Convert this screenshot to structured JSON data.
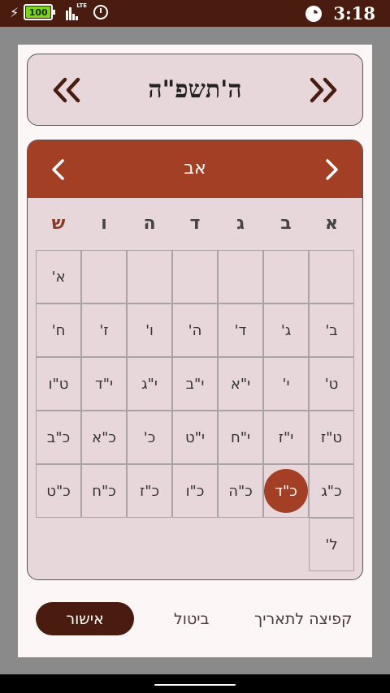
{
  "status_bar": {
    "battery_level": "100",
    "network": "LTE",
    "time": "3:18"
  },
  "year_selector": {
    "year": "ה'תשפ\"ה"
  },
  "month_selector": {
    "month": "אב"
  },
  "weekdays": [
    "א",
    "ב",
    "ג",
    "ד",
    "ה",
    "ו",
    "ש"
  ],
  "days": [
    "א'",
    "ב'",
    "ג'",
    "ד'",
    "ה'",
    "ו'",
    "ז'",
    "ח'",
    "ט'",
    "י'",
    "י\"א",
    "י\"ב",
    "י\"ג",
    "י\"ד",
    "ט\"ו",
    "ט\"ז",
    "י\"ז",
    "י\"ח",
    "י\"ט",
    "כ'",
    "כ\"א",
    "כ\"ב",
    "כ\"ג",
    "כ\"ד",
    "כ\"ה",
    "כ\"ו",
    "כ\"ז",
    "כ\"ח",
    "כ\"ט",
    "ל'"
  ],
  "first_day_column": 6,
  "selected_day": "כ\"ד",
  "actions": {
    "confirm": "אישור",
    "cancel": "ביטול",
    "jump_to_date": "קפיצה לתאריך"
  },
  "colors": {
    "accent": "#a23f24",
    "dark_brown": "#4a1c10",
    "panel": "#e7d7da"
  },
  "icons": {
    "prev_year": "double-chevron-left-icon",
    "next_year": "double-chevron-right-icon",
    "prev_month": "chevron-left-icon",
    "next_month": "chevron-right-icon"
  }
}
